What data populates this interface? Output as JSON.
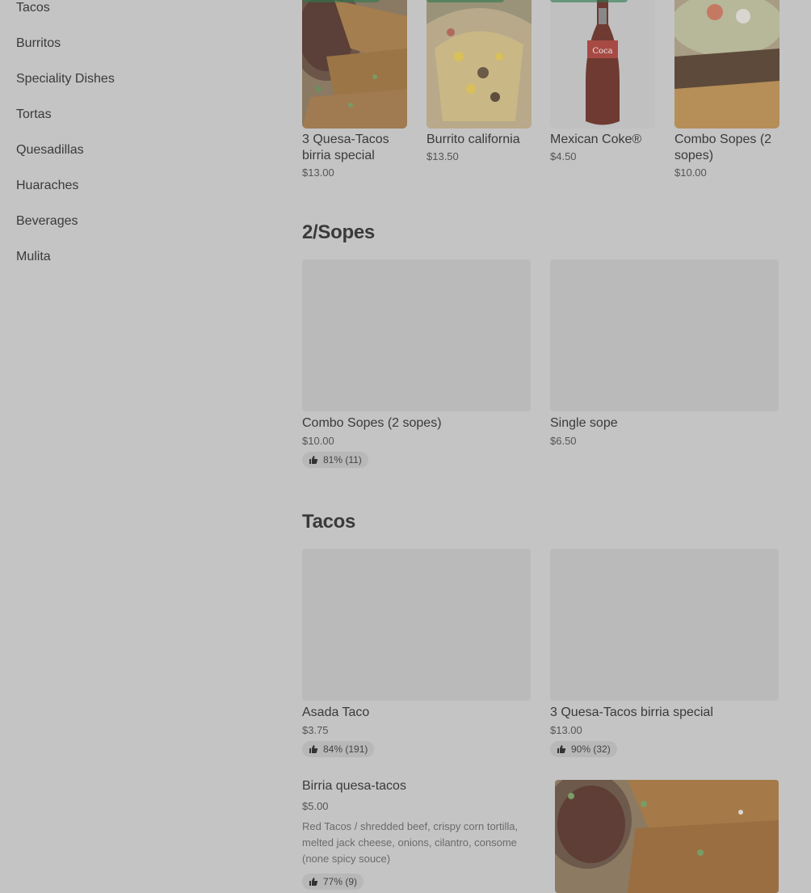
{
  "sidebar": {
    "items": [
      "Tacos",
      "Burritos",
      "Speciality Dishes",
      "Tortas",
      "Quesadillas",
      "Huaraches",
      "Beverages",
      "Mulita"
    ]
  },
  "featured": [
    {
      "name": "3 Quesa-Tacos birria special",
      "price": "$13.00"
    },
    {
      "name": "Burrito california",
      "price": "$13.50"
    },
    {
      "name": "Mexican Coke®",
      "price": "$4.50"
    },
    {
      "name": "Combo Sopes (2 sopes)",
      "price": "$10.00"
    }
  ],
  "sections": {
    "sopes": {
      "title": "2/Sopes",
      "items": [
        {
          "name": "Combo Sopes (2 sopes)",
          "price": "$10.00",
          "rating": "81% (11)"
        },
        {
          "name": "Single sope",
          "price": "$6.50"
        }
      ]
    },
    "tacos": {
      "title": "Tacos",
      "items": [
        {
          "name": "Asada Taco",
          "price": "$3.75",
          "rating": "84% (191)"
        },
        {
          "name": "3 Quesa-Tacos birria special",
          "price": "$13.00",
          "rating": "90% (32)"
        }
      ]
    }
  },
  "birria": {
    "name": "Birria quesa-tacos",
    "price": "$5.00",
    "desc": "Red Tacos / shredded beef, crispy corn tortilla, melted jack cheese, onions, cilantro, consome (none spicy souce)",
    "rating": "77% (9)"
  },
  "colors": {
    "overlay": "#c4c4c4",
    "placeholder": "#bababa",
    "accent": "#2d7a4e"
  }
}
